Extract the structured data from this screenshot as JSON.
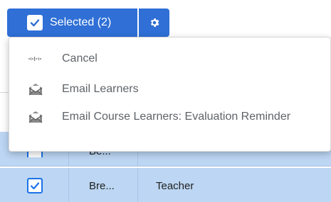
{
  "toolbar": {
    "selected_label": "Selected (2)",
    "accent_color": "#2f6fd6"
  },
  "menu": {
    "items": [
      {
        "label": "Cancel",
        "icon": "cancel-dots-icon"
      },
      {
        "label": "Email Learners",
        "icon": "mail-icon"
      },
      {
        "label": "Email Course Learners: Evaluation Reminder",
        "icon": "mail-icon"
      }
    ]
  },
  "table": {
    "rows": [
      {
        "checked": true,
        "name": "Be...",
        "role": ""
      },
      {
        "checked": true,
        "name": "Bre...",
        "role": "Teacher"
      }
    ],
    "selected_row_color": "#bcd6f3"
  }
}
